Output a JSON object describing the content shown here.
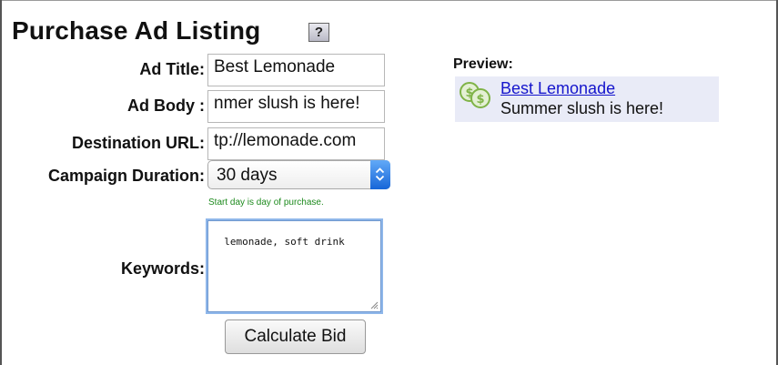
{
  "page": {
    "title": "Purchase Ad Listing",
    "help_label": "?"
  },
  "form": {
    "ad_title": {
      "label": "Ad Title:",
      "value": "Best Lemonade"
    },
    "ad_body": {
      "label": "Ad Body :",
      "value": "Summer slush is here!",
      "visible_value": "nmer slush is here!"
    },
    "destination_url": {
      "label": "Destination URL:",
      "visible_value": "tp://lemonade.com"
    },
    "campaign_duration": {
      "label": "Campaign Duration:",
      "selected": "30 days",
      "hint": "Start day is day of purchase."
    },
    "keywords": {
      "label": "Keywords:",
      "value": "lemonade, soft drink"
    },
    "calculate_label": "Calculate Bid"
  },
  "preview": {
    "label": "Preview:",
    "title": "Best Lemonade",
    "body": "Summer slush is here!",
    "icon": "coins-icon"
  },
  "colors": {
    "link": "#1515cc",
    "hint": "#1d8a1d",
    "preview_bg": "#e9ebf7",
    "select_accent": "#2b7be5",
    "coin": "#7fb347"
  }
}
